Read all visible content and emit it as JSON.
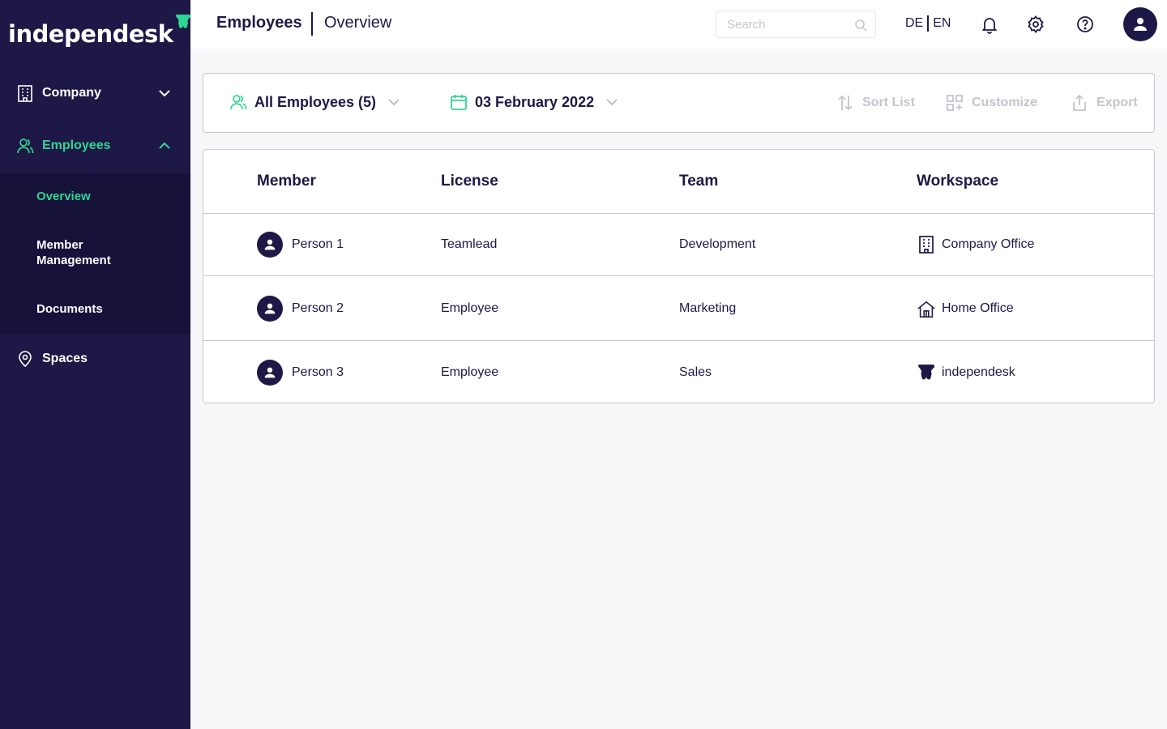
{
  "brand": {
    "name": "independesk",
    "accent": "#2ed693",
    "dark": "#1e1846"
  },
  "sidebar": {
    "items": [
      {
        "label": "Company",
        "icon": "building-icon"
      },
      {
        "label": "Employees",
        "icon": "users-icon"
      },
      {
        "label": "Spaces",
        "icon": "location-pin-icon"
      }
    ],
    "subitems": [
      {
        "label": "Overview"
      },
      {
        "label": "Member Management"
      },
      {
        "label": "Documents"
      }
    ]
  },
  "header": {
    "title": "Employees",
    "subtitle": "Overview",
    "search_placeholder": "Search",
    "lang_de": "DE",
    "lang_en": "EN"
  },
  "toolbar": {
    "filter_label": "All Employees (5)",
    "date_label": "03 February 2022",
    "sort_label": "Sort List",
    "customize_label": "Customize",
    "export_label": "Export"
  },
  "table": {
    "columns": [
      "Member",
      "License",
      "Team",
      "Workspace"
    ],
    "rows": [
      {
        "member": "Person 1",
        "license": "Teamlead",
        "team": "Development",
        "workspace": "Company Office",
        "workspace_icon": "building-icon"
      },
      {
        "member": "Person 2",
        "license": "Employee",
        "team": "Marketing",
        "workspace": "Home Office",
        "workspace_icon": "home-icon"
      },
      {
        "member": "Person 3",
        "license": "Employee",
        "team": "Sales",
        "workspace": "independesk",
        "workspace_icon": "independesk-logo-icon"
      }
    ]
  }
}
